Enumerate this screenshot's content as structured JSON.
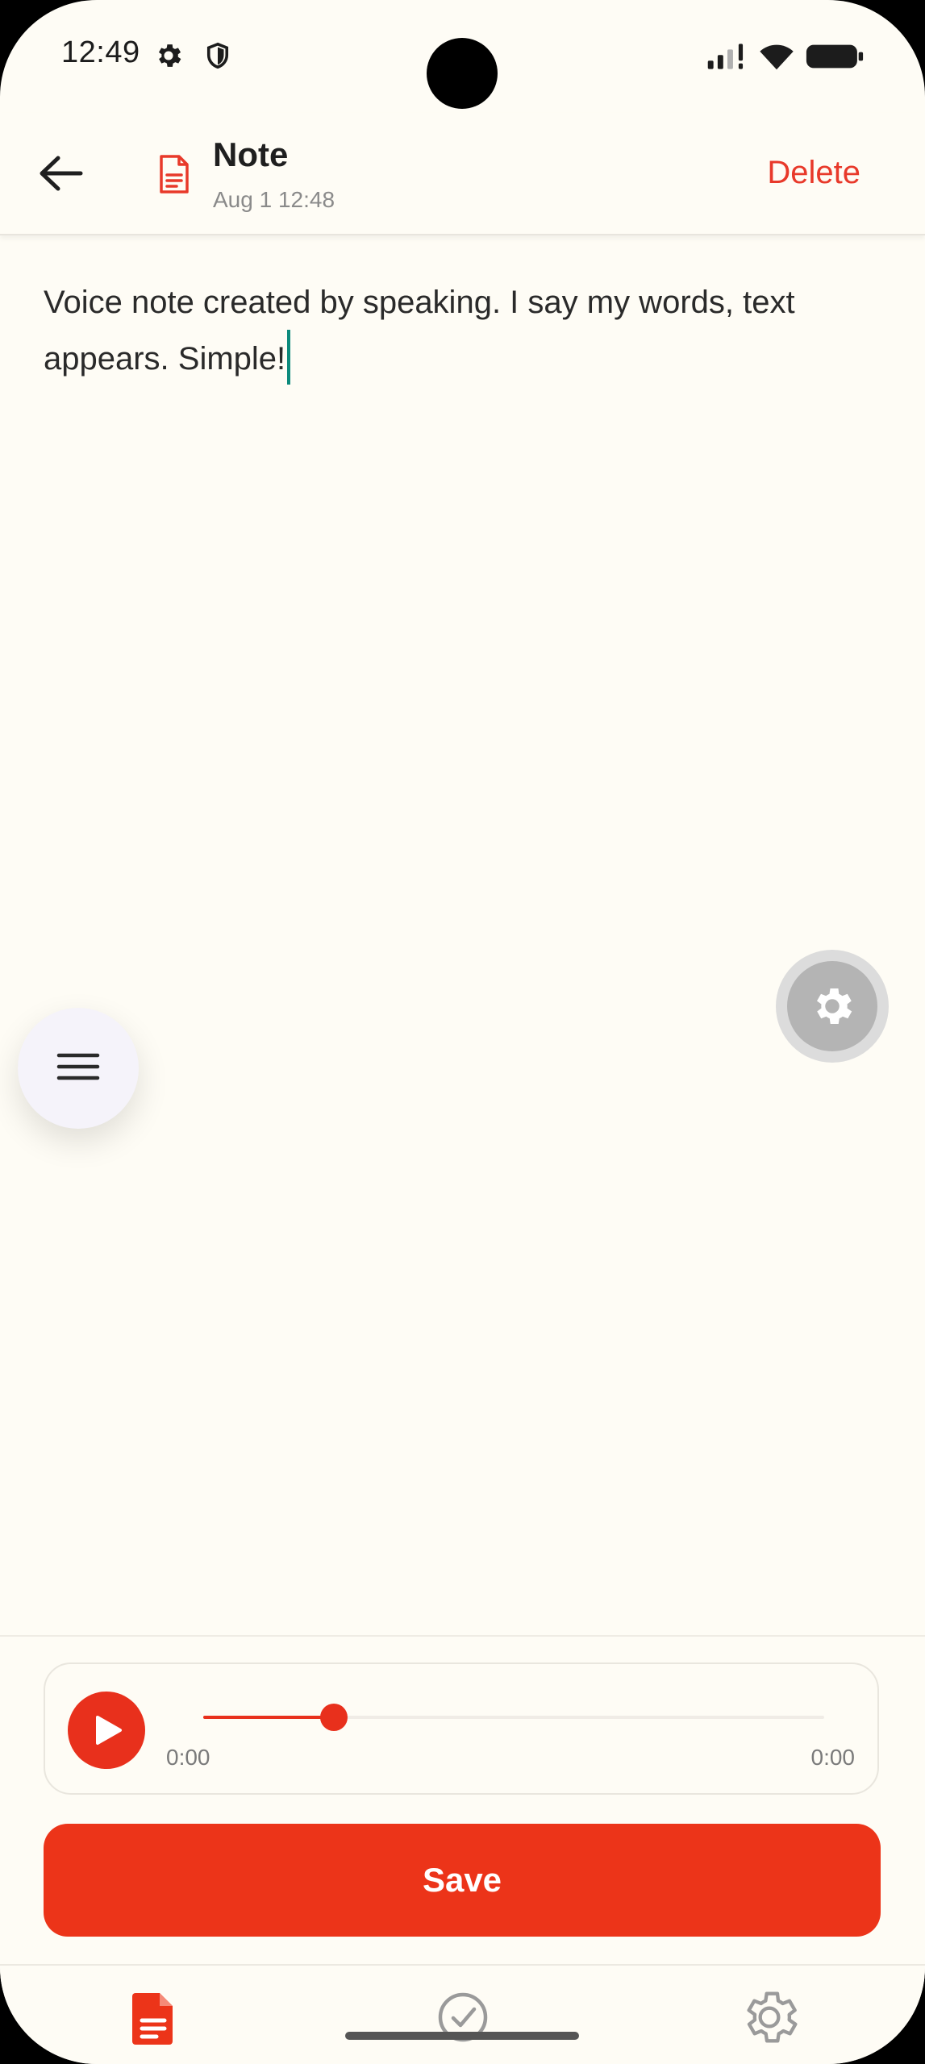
{
  "status_bar": {
    "time": "12:49"
  },
  "header": {
    "back_label": "back",
    "title": "Note",
    "subtitle": "Aug 1 12:48",
    "delete_label": "Delete"
  },
  "editor": {
    "text": "Voice note created by speaking. I say my words, text appears. Simple!"
  },
  "player": {
    "current_time": "0:00",
    "total_time": "0:00",
    "progress_fraction": 0.21
  },
  "actions": {
    "save_label": "Save"
  },
  "nav": {
    "items": [
      "notes",
      "tasks",
      "settings"
    ],
    "active": "notes"
  },
  "colors": {
    "accent": "#ec3419",
    "background": "#fefcf5",
    "cursor": "#0c8a7c",
    "delete": "#e8392a"
  },
  "icons": {
    "status": [
      "gear-icon",
      "shield-icon",
      "signal-icon",
      "wifi-icon",
      "battery-icon"
    ],
    "header": [
      "arrow-left-icon",
      "document-icon"
    ],
    "fabs": [
      "hamburger-menu-icon",
      "gear-icon"
    ],
    "nav": [
      "document-icon",
      "check-circle-icon",
      "gear-icon"
    ]
  }
}
